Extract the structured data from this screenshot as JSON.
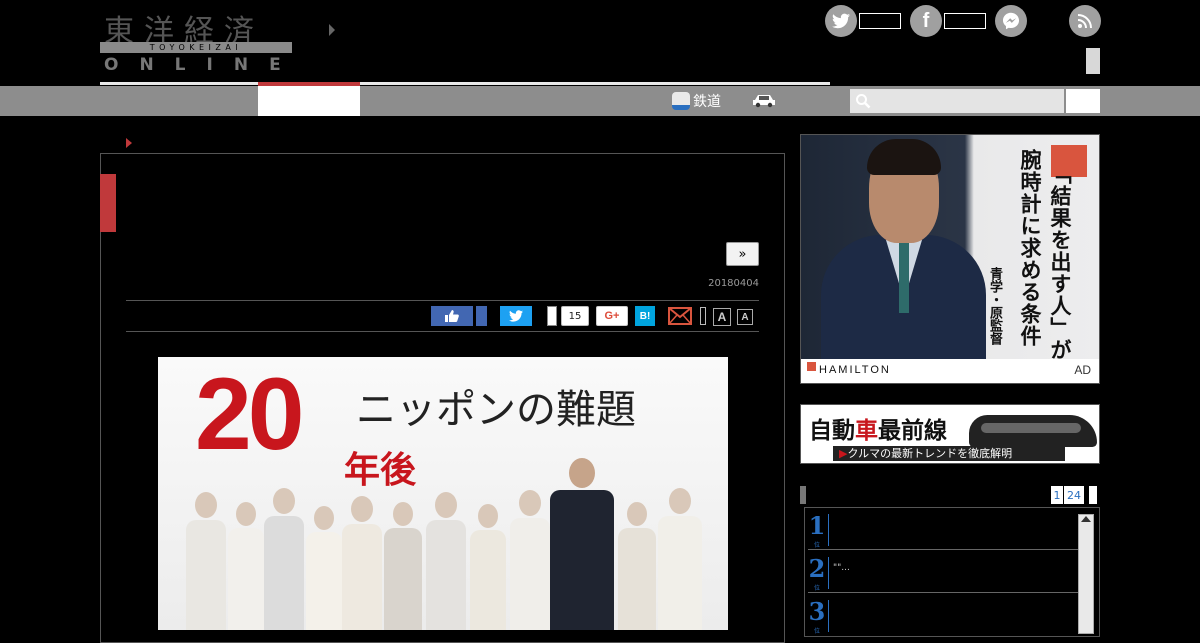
{
  "header": {
    "logo_kanji": "東洋経済",
    "logo_romaji": "TOYOKEIZAI",
    "logo_online": "ONLINE"
  },
  "nav": {
    "rail_label": "鉄道"
  },
  "search": {
    "placeholder": ""
  },
  "article": {
    "next_label": "»",
    "date": "20180404",
    "share": {
      "count": "15",
      "gplus_label": "G+",
      "hatena_label": "B!"
    },
    "font_large_label": "A",
    "font_small_label": "A",
    "hero": {
      "number": "20",
      "nen": "年後",
      "subtitle": "ニッポンの難題"
    }
  },
  "ads": {
    "watch": {
      "headline_1": "「結果を出す人」が",
      "headline_2": "腕時計に求める条件",
      "byline": "青学・原監督",
      "brand": "HAMILTON",
      "ad_label": "AD"
    },
    "car": {
      "title_a": "自動",
      "title_red": "車",
      "title_b": "最前線",
      "tagline_arrow": "▶",
      "tagline": "クルマの最新トレンドを徹底解明"
    }
  },
  "ranking": {
    "tabs": [
      "1",
      "24"
    ],
    "unit": "位",
    "items": [
      {
        "rank": "1",
        "title": ""
      },
      {
        "rank": "2",
        "title": "\"\"..."
      },
      {
        "rank": "3",
        "title": ""
      }
    ]
  },
  "colors": {
    "accent_red": "#c0393b",
    "nav_gray": "#8d8d8d",
    "link_blue": "#2a6fc0"
  }
}
